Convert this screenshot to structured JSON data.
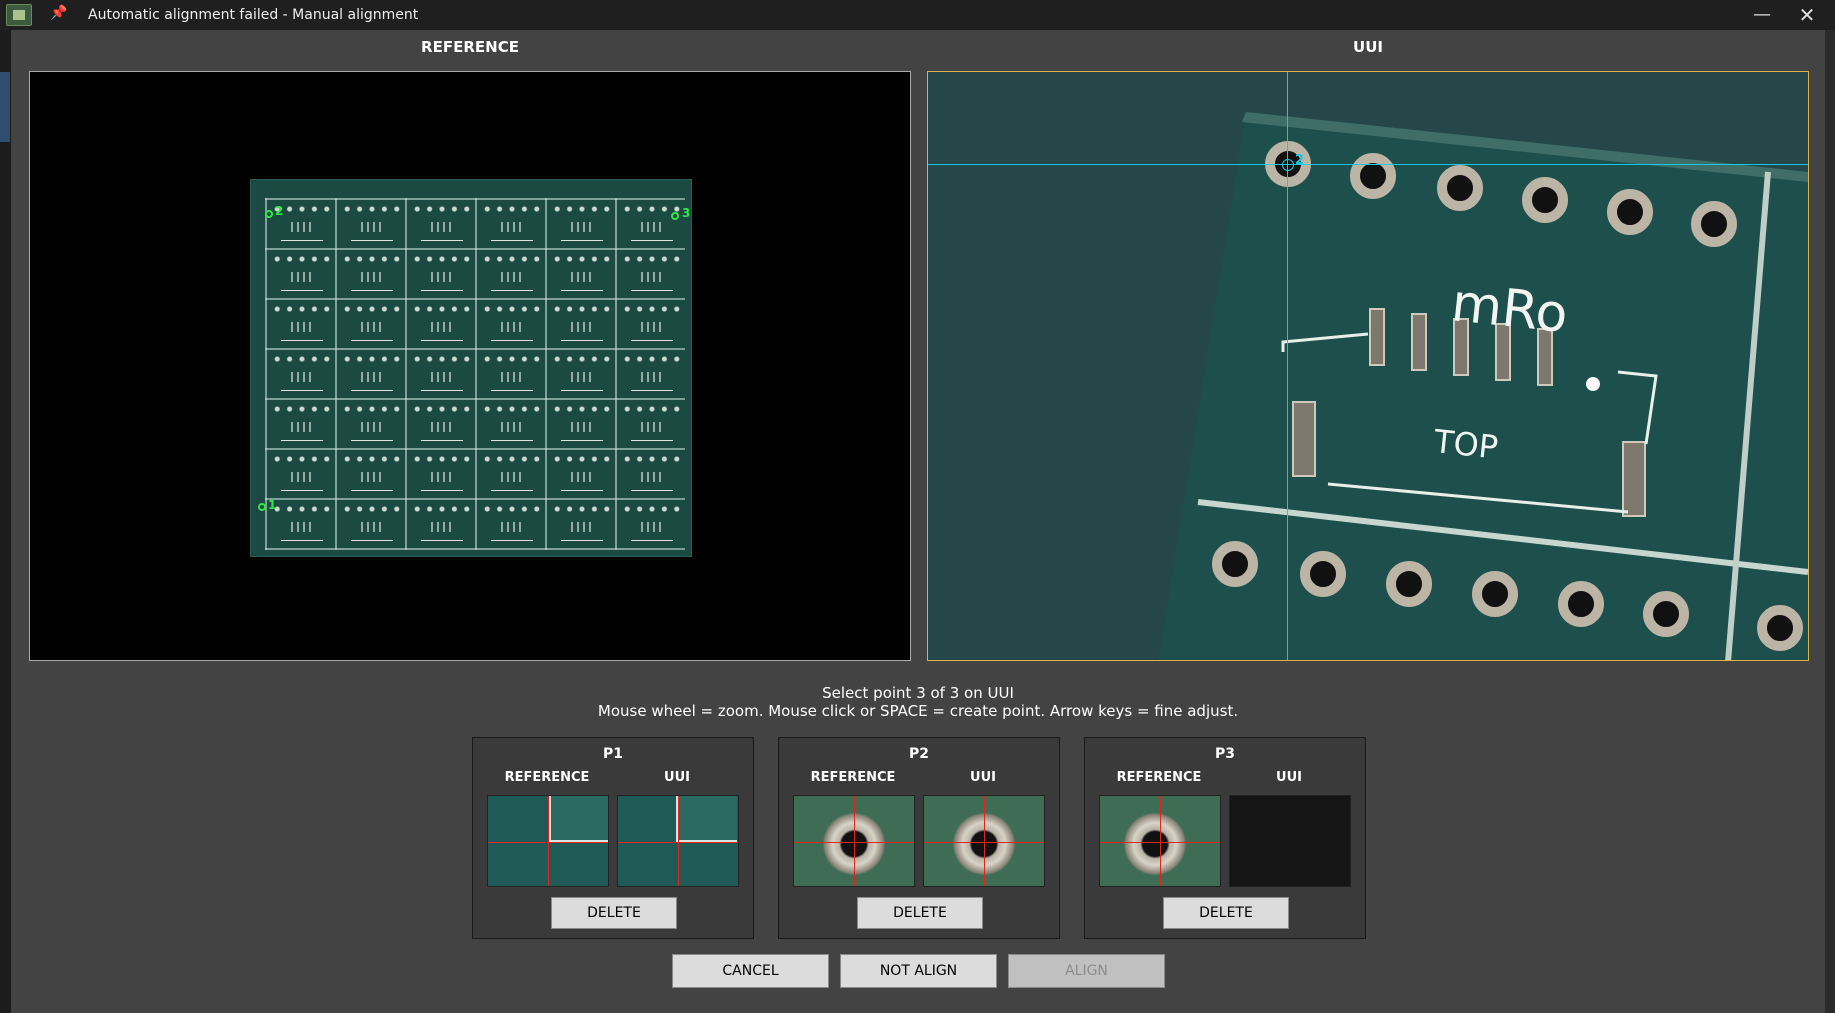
{
  "window": {
    "title": "Automatic alignment failed - Manual alignment",
    "minimize_glyph": "—",
    "close_glyph": "✕",
    "pin_glyph": "📌"
  },
  "reference_pane": {
    "title": "REFERENCE",
    "fiducials": [
      {
        "label": "2"
      },
      {
        "label": "3"
      },
      {
        "label": "1"
      }
    ]
  },
  "uui_pane": {
    "title": "UUI",
    "marker_label": "2"
  },
  "messages": {
    "line1": "Select point 3 of 3 on UUI",
    "line2": "Mouse wheel = zoom. Mouse click or SPACE = create point. Arrow keys = fine adjust."
  },
  "points": [
    {
      "title": "P1",
      "ref_label": "REFERENCE",
      "uui_label": "UUI",
      "delete_label": "DELETE"
    },
    {
      "title": "P2",
      "ref_label": "REFERENCE",
      "uui_label": "UUI",
      "delete_label": "DELETE"
    },
    {
      "title": "P3",
      "ref_label": "REFERENCE",
      "uui_label": "UUI",
      "delete_label": "DELETE"
    }
  ],
  "actions": {
    "cancel": "CANCEL",
    "not_align": "NOT ALIGN",
    "align": "ALIGN"
  },
  "colors": {
    "fiducial": "#32e64a",
    "crosshair_uui": "#17c8e0",
    "crosshair_thumb": "#e0251f",
    "uui_border": "#d8b24a"
  }
}
